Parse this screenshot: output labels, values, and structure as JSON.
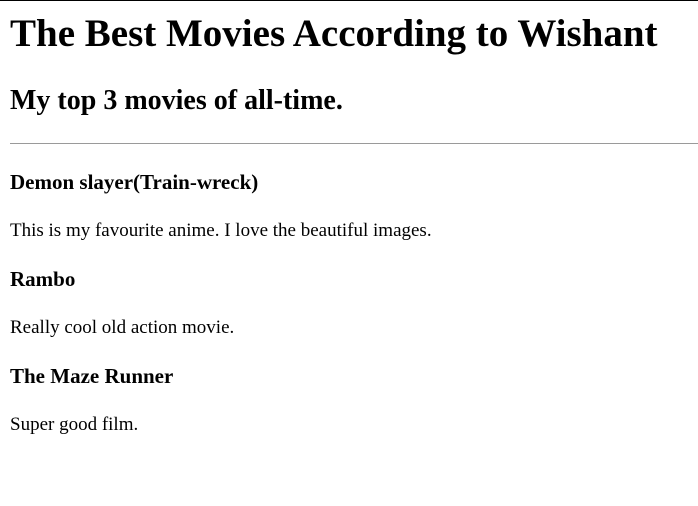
{
  "page": {
    "title": "The Best Movies According to Wishant",
    "subtitle": "My top 3 movies of all-time."
  },
  "movies": [
    {
      "title": "Demon slayer(Train-wreck)",
      "description": "This is my favourite anime. I love the beautiful images."
    },
    {
      "title": "Rambo",
      "description": "Really cool old action movie."
    },
    {
      "title": "The Maze Runner",
      "description": "Super good film."
    }
  ]
}
